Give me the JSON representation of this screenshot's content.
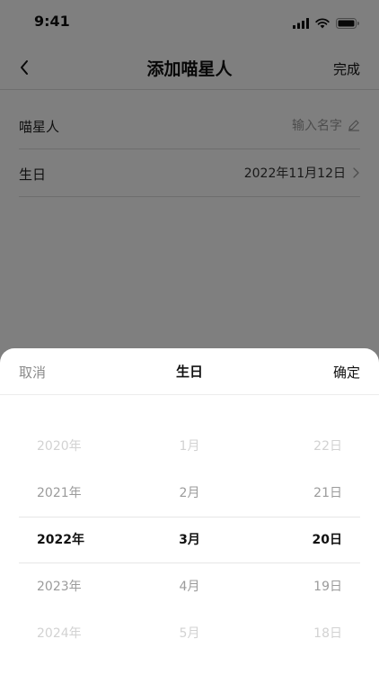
{
  "status_bar": {
    "time": "9:41"
  },
  "nav": {
    "title": "添加喵星人",
    "done_label": "完成"
  },
  "form": {
    "name_label": "喵星人",
    "name_placeholder": "输入名字",
    "birthday_label": "生日",
    "birthday_value": "2022年11月12日"
  },
  "sheet": {
    "cancel_label": "取消",
    "title": "生日",
    "confirm_label": "确定"
  },
  "picker": {
    "years": [
      "2020年",
      "2021年",
      "2022年",
      "2023年",
      "2024年"
    ],
    "months": [
      "1月",
      "2月",
      "3月",
      "4月",
      "5月"
    ],
    "days": [
      "22日",
      "21日",
      "20日",
      "19日",
      "18日"
    ],
    "selected_index": 2
  },
  "colors": {
    "overlay": "#000000",
    "text_primary": "#111111",
    "text_muted": "#9b9b9b",
    "divider": "#dcdcdc"
  },
  "icons": [
    "signal-icon",
    "wifi-icon",
    "battery-icon",
    "back-chevron-icon",
    "edit-pencil-icon",
    "chevron-right-icon"
  ]
}
